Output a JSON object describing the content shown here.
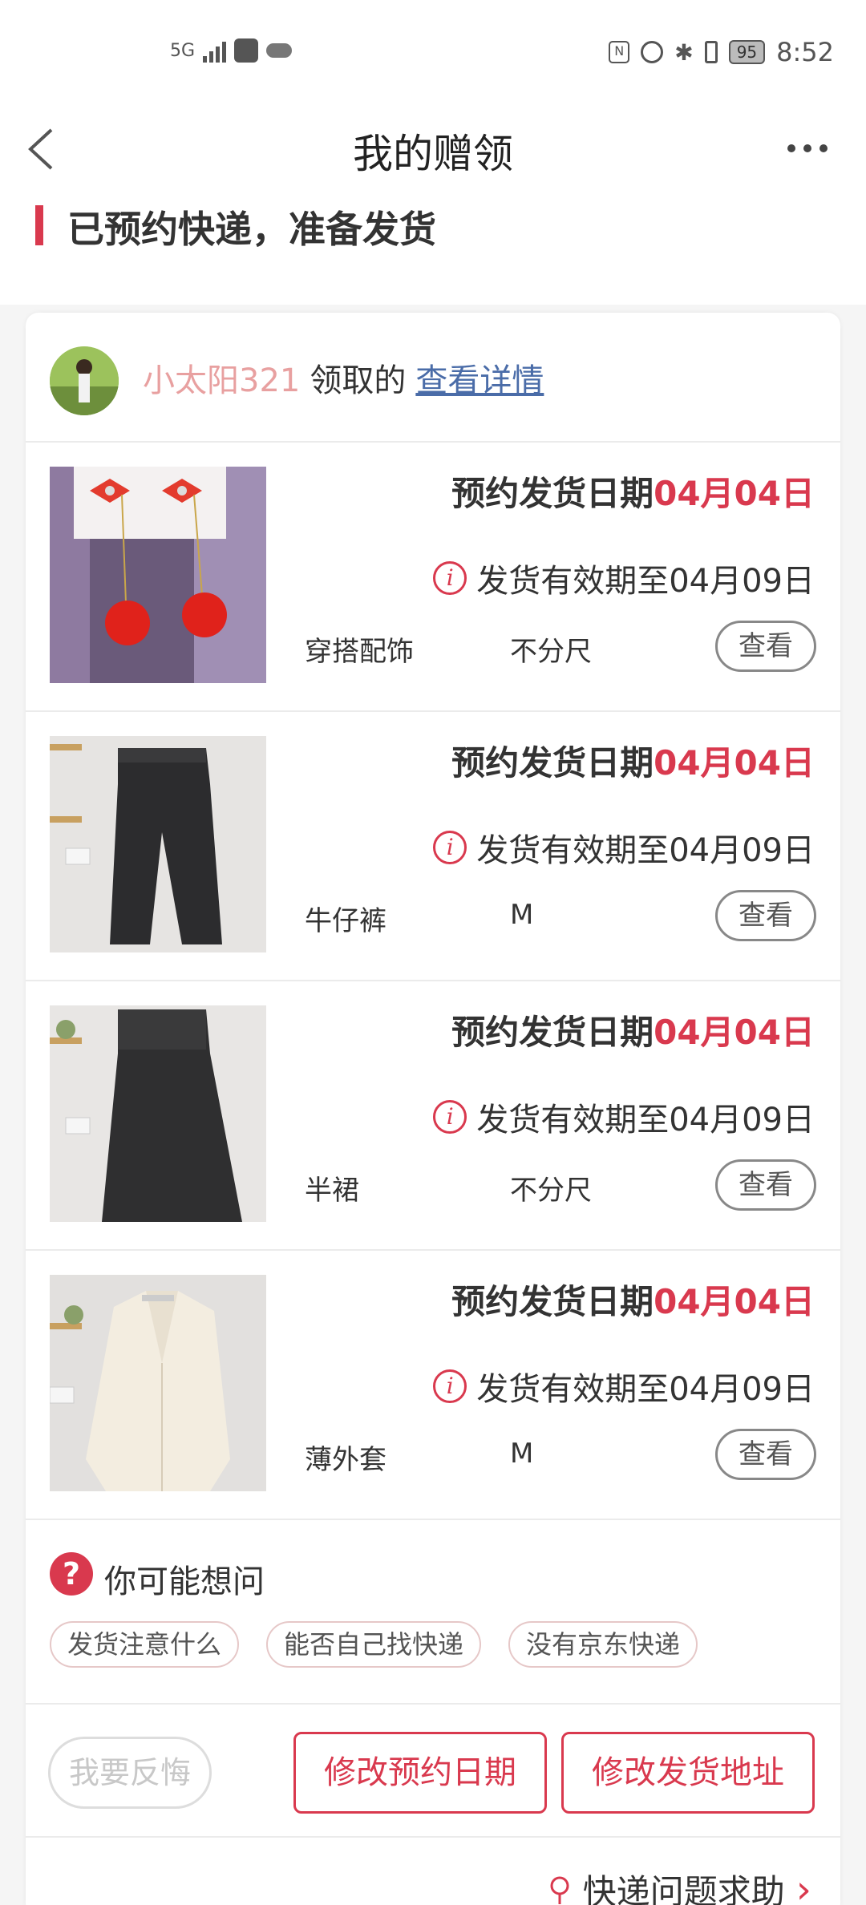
{
  "status_bar": {
    "network": "5G",
    "battery": "95",
    "time": "8:52",
    "nfc": "N"
  },
  "nav": {
    "title": "我的赠领"
  },
  "status_heading": "已预约快递，准备发货",
  "owner": {
    "name": "小太阳321",
    "suffix": "领取的",
    "link": "查看详情"
  },
  "items": [
    {
      "date_label": "预约发货日期",
      "date_value": "04月04日",
      "valid": "发货有效期至04月09日",
      "category": "穿搭配饰",
      "size": "不分尺",
      "view": "查看",
      "image": "red-earrings"
    },
    {
      "date_label": "预约发货日期",
      "date_value": "04月04日",
      "valid": "发货有效期至04月09日",
      "category": "牛仔裤",
      "size": "M",
      "view": "查看",
      "image": "black-jeans"
    },
    {
      "date_label": "预约发货日期",
      "date_value": "04月04日",
      "valid": "发货有效期至04月09日",
      "category": "半裙",
      "size": "不分尺",
      "view": "查看",
      "image": "black-skirt"
    },
    {
      "date_label": "预约发货日期",
      "date_value": "04月04日",
      "valid": "发货有效期至04月09日",
      "category": "薄外套",
      "size": "M",
      "view": "查看",
      "image": "cream-jacket"
    }
  ],
  "faq": {
    "icon": "?",
    "title": "你可能想问",
    "chips": [
      "发货注意什么",
      "能否自己找快递",
      "没有京东快递"
    ]
  },
  "actions": {
    "regret": "我要反悔",
    "change_date": "修改预约日期",
    "change_address": "修改发货地址"
  },
  "help": {
    "label": "快递问题求助",
    "arrow": "›"
  },
  "colors": {
    "accent": "#d9394e",
    "link": "#4a6ca8",
    "owner_name": "#e8a0a0"
  },
  "icons": {
    "back": "chevron-left-icon",
    "more": "more-dots-icon",
    "info": "info-icon",
    "location": "location-pin-icon"
  }
}
